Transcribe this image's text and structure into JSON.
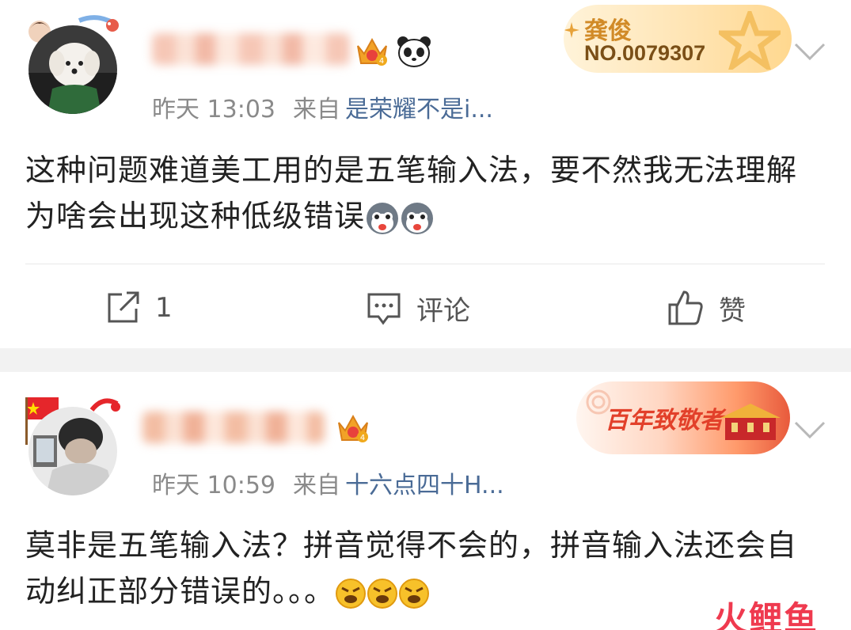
{
  "posts": [
    {
      "time": "昨天 13:03",
      "from_label": "来自",
      "source": "是荣耀不是i...",
      "badge_title": "龚俊",
      "badge_number": "NO.0079307",
      "content": "这种问题难道美工用的是五笔输入法，要不然我无法理解为啥会出现这种低级错误",
      "crown_level": "4",
      "actions": {
        "repost": "1",
        "comment": "评论",
        "like": "赞"
      }
    },
    {
      "time": "昨天 10:59",
      "from_label": "来自",
      "source": "十六点四十H...",
      "badge_title": "百年致敬者",
      "content": "莫非是五笔输入法？拼音觉得不会的，拼音输入法还会自动纠正部分错误的。。。",
      "crown_level": "4"
    }
  ],
  "watermark": "火鲤鱼",
  "colors": {
    "source_link": "#4a6b96",
    "meta_gray": "#8a8a8a",
    "watermark_red": "#ef3a4f",
    "separator": "#f2f2f2"
  },
  "icons": [
    "repost-icon",
    "comment-icon",
    "like-icon",
    "chevron-down-icon",
    "crown-icon",
    "panda-icon",
    "husky-emoji",
    "angry-emoji"
  ]
}
